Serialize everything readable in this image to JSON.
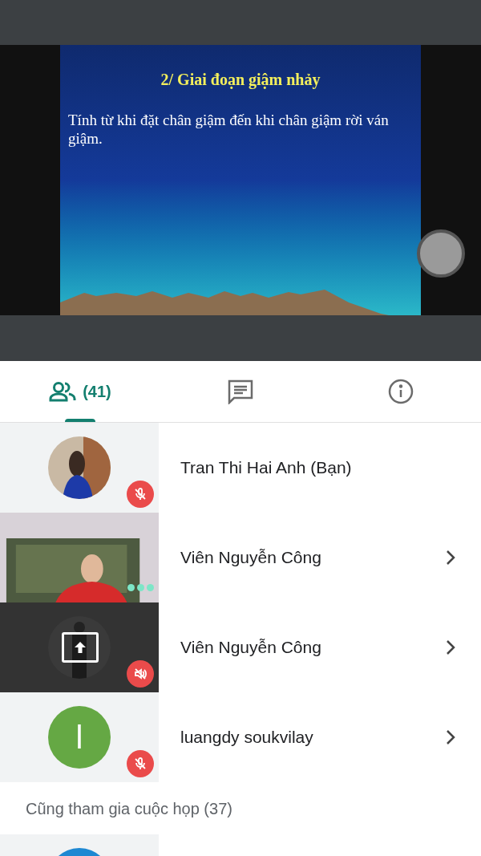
{
  "slide": {
    "title": "2/ Giai đoạn giậm nhảy",
    "body": "Tính từ khi đặt chân giậm đến khi chân giậm rời ván giậm."
  },
  "tabs": [
    {
      "kind": "people",
      "label": "(41)",
      "selected": true
    },
    {
      "kind": "chat",
      "selected": false
    },
    {
      "kind": "info",
      "selected": false
    }
  ],
  "participants": [
    {
      "name": "Tran Thi Hai Anh (Bạn)",
      "indicator": {
        "kind": "mic-off"
      },
      "chevron": false
    },
    {
      "name": "Viên Nguyễn Công",
      "kind": "video",
      "indicator": {
        "kind": "speaking"
      },
      "chevron": true
    },
    {
      "name": "Viên Nguyễn Công",
      "kind": "screen-share",
      "indicator": {
        "kind": "audio-off"
      },
      "chevron": true
    },
    {
      "name": "luangdy soukvilay",
      "kind": "initial",
      "initial": "l",
      "color": "#65a844",
      "indicator": {
        "kind": "mic-off"
      },
      "chevron": true
    }
  ],
  "section_title": "Cũng tham gia cuộc họp (37)",
  "more_participants": [
    {
      "kind": "initial",
      "color": "#1e88d2"
    }
  ]
}
